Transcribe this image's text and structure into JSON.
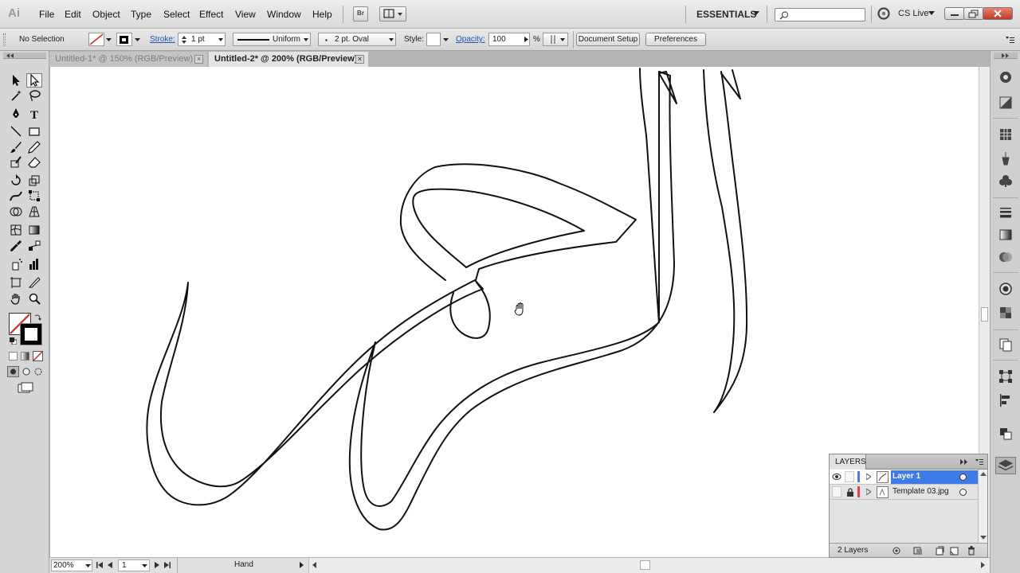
{
  "app": {
    "logo": "Ai"
  },
  "menu": [
    "File",
    "Edit",
    "Object",
    "Type",
    "Select",
    "Effect",
    "View",
    "Window",
    "Help"
  ],
  "menubar": {
    "bridge_label": "Br",
    "workspace": "ESSENTIALS",
    "search_placeholder": "",
    "cs_live": "CS Live"
  },
  "control": {
    "selection": "No Selection",
    "stroke_label": "Stroke:",
    "stroke_weight": "1 pt",
    "profile": "Uniform",
    "brush": "2 pt. Oval",
    "style_label": "Style:",
    "opacity_label": "Opacity:",
    "opacity_value": "100",
    "percent": "%",
    "document_setup": "Document Setup",
    "preferences": "Preferences"
  },
  "tabs": [
    {
      "label": "Untitled-1* @ 150% (RGB/Preview)",
      "active": false
    },
    {
      "label": "Untitled-2* @ 200% (RGB/Preview)",
      "active": true
    }
  ],
  "status": {
    "zoom": "200%",
    "page": "1",
    "tool": "Hand"
  },
  "layers": {
    "title": "LAYERS",
    "rows": [
      {
        "name": "Layer 1",
        "selected": true,
        "color": "#4a7cf0"
      },
      {
        "name": "Template 03.jpg",
        "selected": false,
        "color": "#e0474c"
      }
    ],
    "count": "2 Layers"
  },
  "colors": {
    "accent": "#3d7be8",
    "canvas": "#ffffff",
    "ui_gray": "#d6d6d6"
  }
}
